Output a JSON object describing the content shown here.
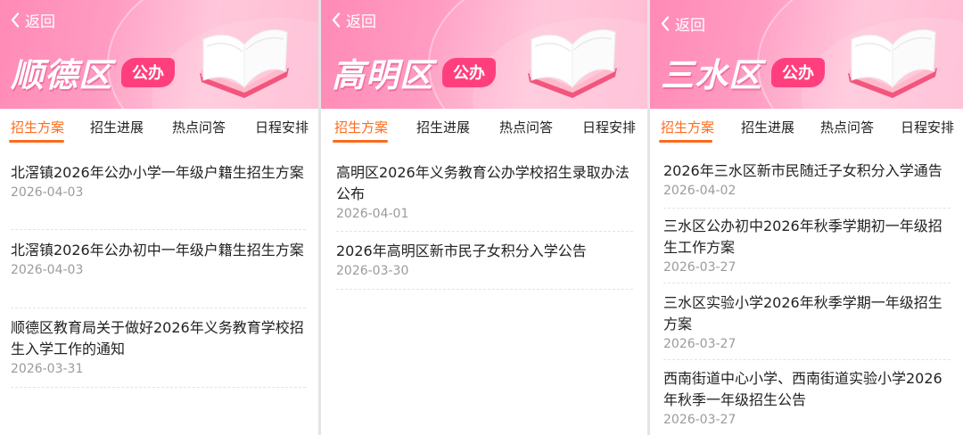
{
  "back_label": "返回",
  "panels": [
    {
      "district": "顺德区",
      "badge": "公办",
      "tabs": [
        "招生方案",
        "招生进展",
        "热点问答",
        "日程安排"
      ],
      "items": [
        {
          "title": "北滘镇2026年公办小学一年级户籍生招生方案",
          "date": "2026-04-03"
        },
        {
          "title": "北滘镇2026年公办初中一年级户籍生招生方案",
          "date": "2026-04-03"
        },
        {
          "title": "顺德区教育局关于做好2026年义务教育学校招生入学工作的通知",
          "date": "2026-03-31"
        }
      ]
    },
    {
      "district": "高明区",
      "badge": "公办",
      "tabs": [
        "招生方案",
        "招生进展",
        "热点问答",
        "日程安排"
      ],
      "items": [
        {
          "title": "高明区2026年义务教育公办学校招生录取办法公布",
          "date": "2026-04-01"
        },
        {
          "title": "2026年高明区新市民子女积分入学公告",
          "date": "2026-03-30"
        }
      ]
    },
    {
      "district": "三水区",
      "badge": "公办",
      "tabs": [
        "招生方案",
        "招生进展",
        "热点问答",
        "日程安排"
      ],
      "items": [
        {
          "title": "2026年三水区新市民随迁子女积分入学通告",
          "date": "2026-04-02"
        },
        {
          "title": "三水区公办初中2026年秋季学期初一年级招生工作方案",
          "date": "2026-03-27"
        },
        {
          "title": "三水区实验小学2026年秋季学期一年级招生方案",
          "date": "2026-03-27"
        },
        {
          "title": "西南街道中心小学、西南街道实验小学2026年秋季一年级招生公告",
          "date": "2026-03-27"
        }
      ]
    }
  ],
  "colors": {
    "accent": "#ff6a1a",
    "badge": "#ff3f7d",
    "header_pink": "#ff8ab6"
  },
  "icons": {
    "back": "chevron-left-icon",
    "illustration": "open-book-icon"
  }
}
